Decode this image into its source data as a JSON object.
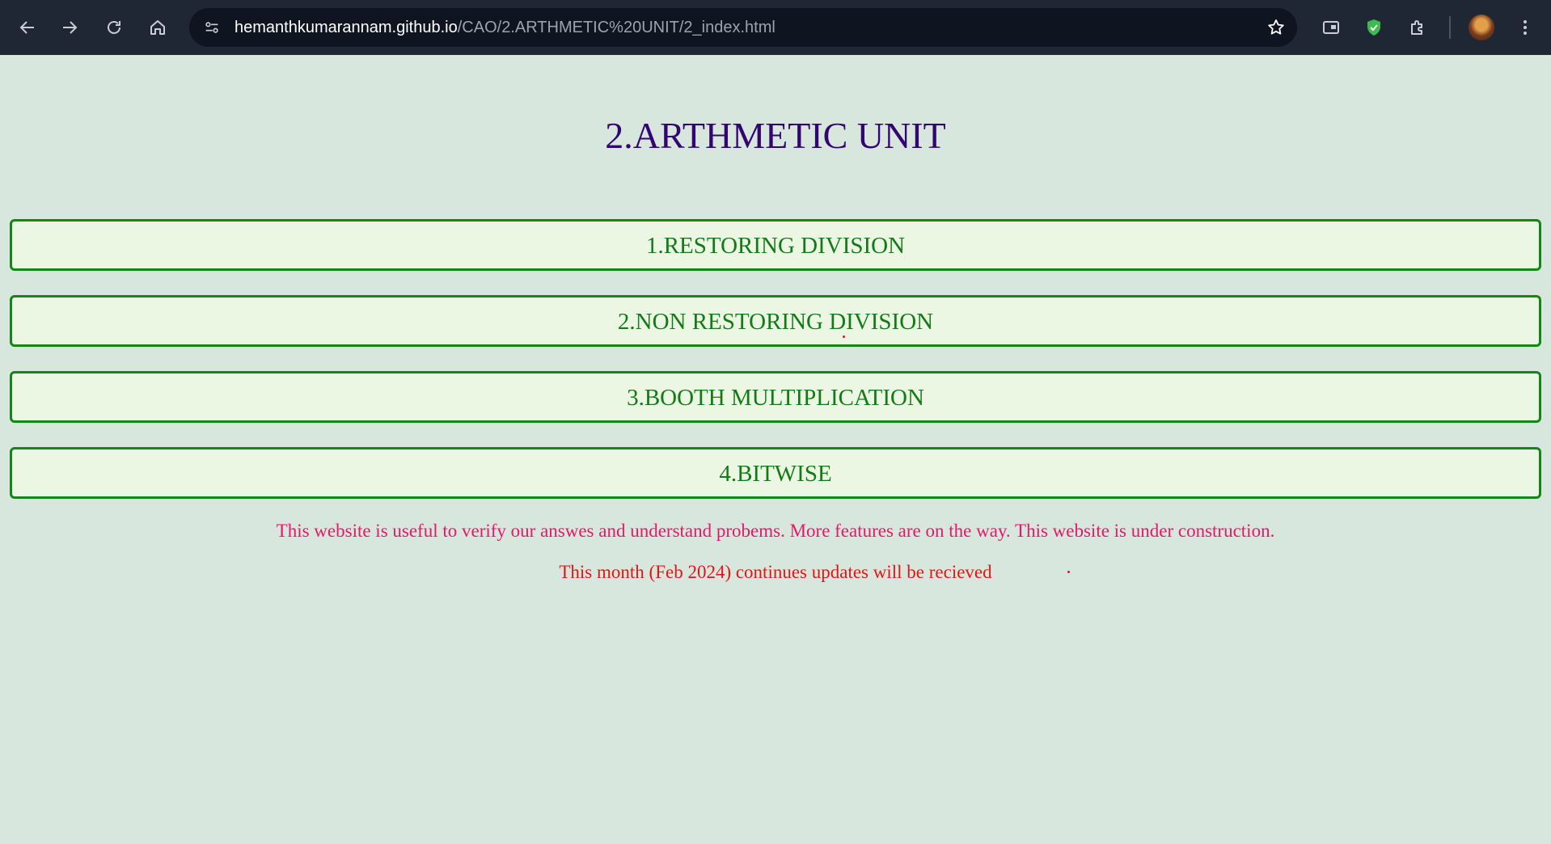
{
  "browser": {
    "url_host": "hemanthkumarannam.github.io",
    "url_path": "/CAO/2.ARTHMETIC%20UNIT/2_index.html",
    "icons": [
      "back-arrow-icon",
      "forward-arrow-icon",
      "reload-icon",
      "home-icon",
      "site-info-icon",
      "bookmark-star-icon",
      "reading-mode-icon",
      "shield-extension-icon",
      "extensions-puzzle-icon",
      "profile-avatar",
      "more-menu-icon"
    ]
  },
  "page": {
    "title": "2.ARTHMETIC UNIT",
    "menu": [
      {
        "label": "1.RESTORING DIVISION"
      },
      {
        "label": "2.NON RESTORING DIVISION"
      },
      {
        "label": "3.BOOTH MULTIPLICATION"
      },
      {
        "label": "4.BITWISE"
      }
    ],
    "notes": {
      "info": "This website is useful to verify our answes and understand probems. More features are on the way. This website is under construction.",
      "update": "This month (Feb 2024) continues updates will be recieved"
    }
  },
  "colors": {
    "background": "#d8e7dd",
    "title": "#330572",
    "button_border": "#138617",
    "button_bg": "#ebf7e3",
    "button_text": "#127a16",
    "note_info": "#e3186a",
    "note_update": "#e21515"
  }
}
